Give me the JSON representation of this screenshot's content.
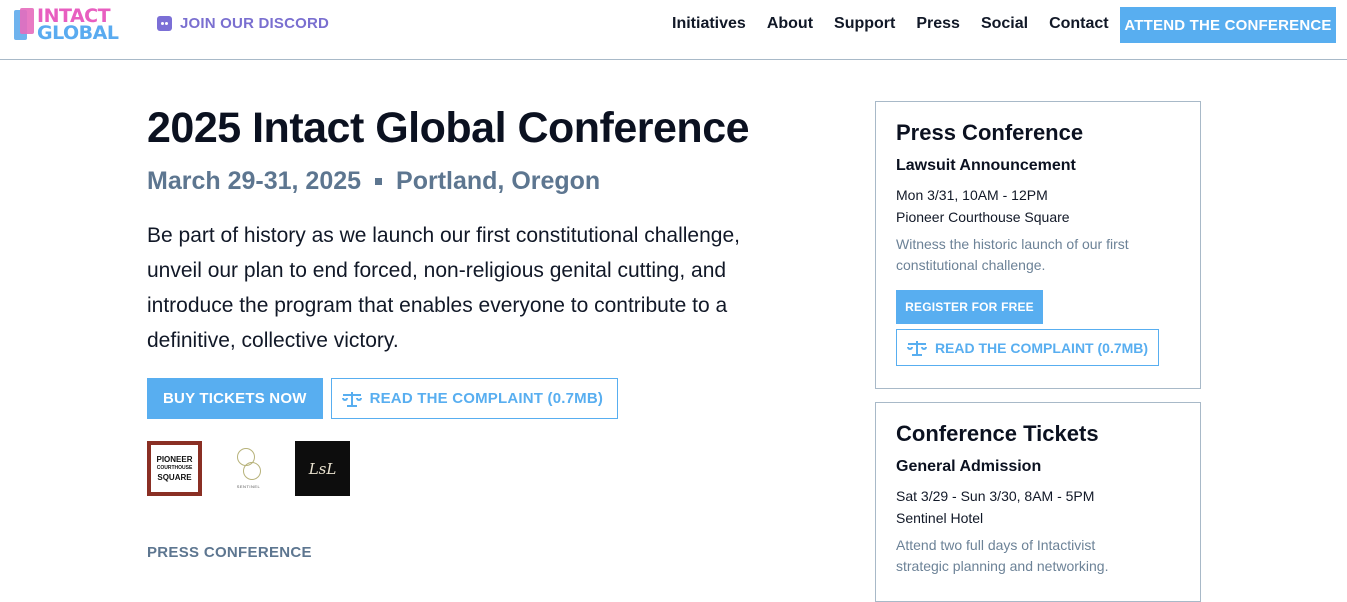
{
  "header": {
    "logo": {
      "line1": "INTACT",
      "line2": "GLOBAL"
    },
    "discord_label": "JOIN OUR DISCORD",
    "nav": [
      "Initiatives",
      "About",
      "Support",
      "Press",
      "Social",
      "Contact"
    ],
    "cta_label": "ATTEND THE CONFERENCE"
  },
  "main": {
    "title": "2025 Intact Global Conference",
    "date": "March 29-31, 2025",
    "location": "Portland, Oregon",
    "intro": "Be part of history as we launch our first constitutional challenge, unveil our plan to end forced, non-religious genital cutting, and introduce the program that enables everyone to contribute to a definitive, collective victory.",
    "buy_label": "BUY TICKETS NOW",
    "complaint_label": "READ THE COMPLAINT (0.7MB)",
    "sponsors": {
      "pcs": [
        "PIONEER",
        "COURTHOUSE",
        "SQUARE"
      ],
      "sentinel": "SENTINEL",
      "lsl": "LsL"
    },
    "section_label": "PRESS CONFERENCE"
  },
  "sidebar": {
    "press": {
      "title": "Press Conference",
      "subtitle": "Lawsuit Announcement",
      "when": "Mon 3/31, 10AM - 12PM",
      "where": "Pioneer Courthouse Square",
      "desc": "Witness the historic launch of our first constitutional challenge.",
      "register_label": "REGISTER FOR FREE",
      "complaint_label": "READ THE COMPLAINT (0.7MB)"
    },
    "tickets": {
      "title": "Conference Tickets",
      "subtitle": "General Admission",
      "when": "Sat 3/29 - Sun 3/30, 8AM - 5PM",
      "where": "Sentinel Hotel",
      "desc": "Attend two full days of Intactivist strategic planning and networking."
    }
  },
  "colors": {
    "accent": "#58aef0",
    "muted": "#5d7690",
    "discord": "#7a6fd0",
    "logo_pink": "#e85ec0",
    "logo_blue": "#5aabf0"
  }
}
